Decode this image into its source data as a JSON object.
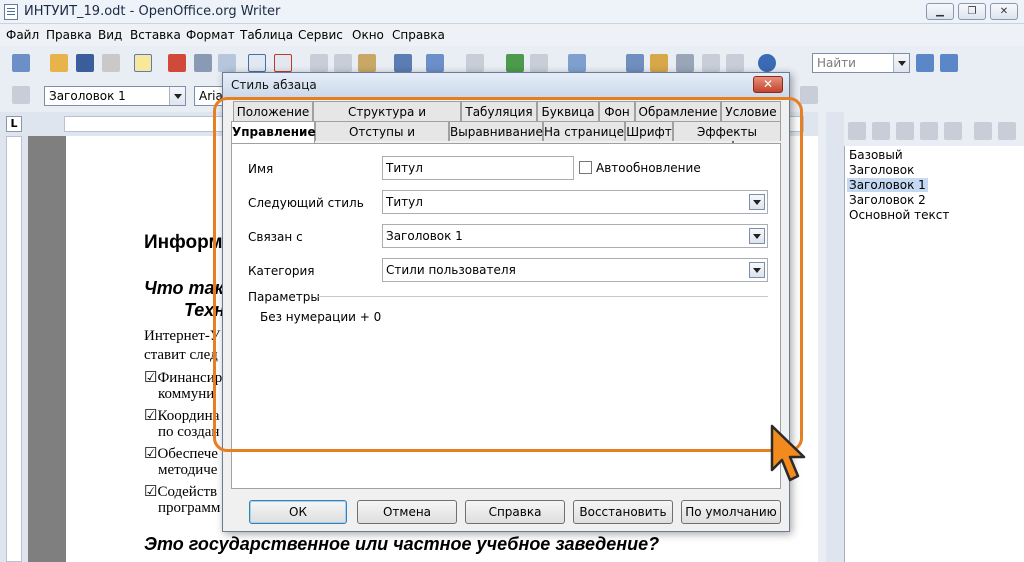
{
  "window": {
    "title": "ИНТУИТ_19.odt - OpenOffice.org Writer",
    "minimize": "▁",
    "maximize": "❐",
    "close": "✕"
  },
  "menu": [
    {
      "label": "Файл"
    },
    {
      "label": "Правка"
    },
    {
      "label": "Вид"
    },
    {
      "label": "Вставка"
    },
    {
      "label": "Формат"
    },
    {
      "label": "Таблица"
    },
    {
      "label": "Сервис"
    },
    {
      "label": "Окно"
    },
    {
      "label": "Справка"
    }
  ],
  "toolbar": {
    "find_placeholder": "Найти",
    "style_value": "Заголовок 1",
    "font_value": "Arial"
  },
  "document": {
    "heading": "Информ",
    "sub1": "Что так",
    "sub2": "Техн",
    "p1": "Интернет-У",
    "p2": "ставит след",
    "b1a": "☑Финансир",
    "b1b": "коммуни",
    "b2a": "☑Координа",
    "b2b": "по создан",
    "b3a": "☑Обеспече",
    "b3b": "методиче",
    "b4a": "☑Содейств",
    "b4b": "программ",
    "bottom": "Это государственное или частное учебное заведение?"
  },
  "styles_list": [
    {
      "label": "Базовый"
    },
    {
      "label": "Заголовок"
    },
    {
      "label": "Заголовок 1"
    },
    {
      "label": "Заголовок 2"
    },
    {
      "label": "Основной текст"
    }
  ],
  "dialog": {
    "title": "Стиль абзаца",
    "tabs_row1": [
      {
        "label": "Положение"
      },
      {
        "label": "Структура и нумерация"
      },
      {
        "label": "Табуляция"
      },
      {
        "label": "Буквица"
      },
      {
        "label": "Фон"
      },
      {
        "label": "Обрамление"
      },
      {
        "label": "Условие"
      }
    ],
    "tabs_row2": [
      {
        "label": "Управление"
      },
      {
        "label": "Отступы и интервалы"
      },
      {
        "label": "Выравнивание"
      },
      {
        "label": "На странице"
      },
      {
        "label": "Шрифт"
      },
      {
        "label": "Эффекты шрифта"
      }
    ],
    "name_label": "Имя",
    "name_value": "Титул",
    "autoupdate_label": "Автообновление",
    "next_style_label": "Следующий стиль",
    "next_style_value": "Титул",
    "linked_label": "Связан с",
    "linked_value": "Заголовок 1",
    "category_label": "Категория",
    "category_value": "Стили пользователя",
    "params_label": "Параметры",
    "params_value": "Без нумерации + 0",
    "buttons": {
      "ok": "ОК",
      "cancel": "Отмена",
      "help": "Справка",
      "reset": "Восстановить",
      "default": "По умолчанию"
    }
  },
  "colors": {
    "highlight": "#e67e22",
    "accent": "#3c7fb1"
  }
}
